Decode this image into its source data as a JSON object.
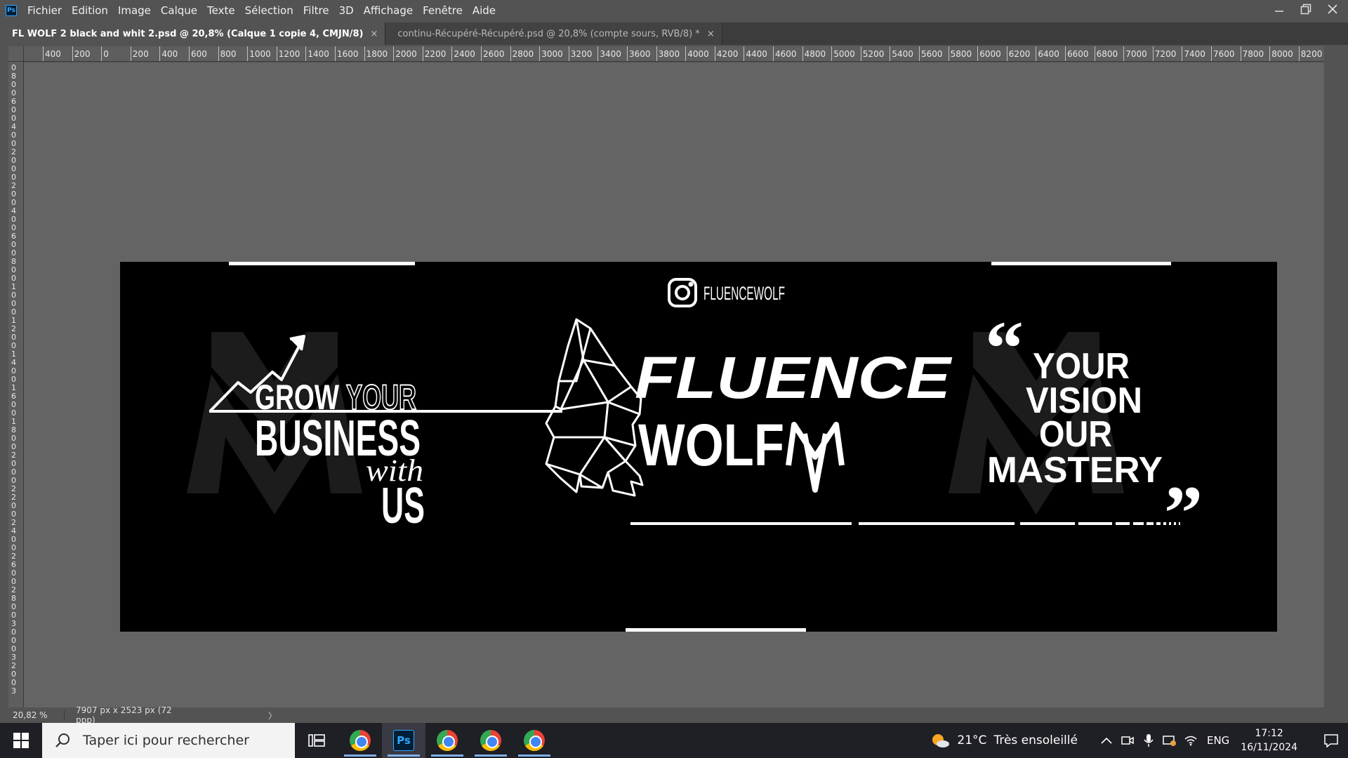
{
  "app": {
    "logo_text": "Ps",
    "menu": [
      "Fichier",
      "Edition",
      "Image",
      "Calque",
      "Texte",
      "Sélection",
      "Filtre",
      "3D",
      "Affichage",
      "Fenêtre",
      "Aide"
    ]
  },
  "tabs": [
    {
      "label": "FL WOLF 2 black and whit 2.psd @ 20,8% (Calque 1 copie 4, CMJN/8)",
      "close": "×",
      "active": true
    },
    {
      "label": "continu-Récupéré-Récupéré.psd @ 20,8% (compte sours, RVB/8) *",
      "close": "×",
      "active": false
    }
  ],
  "ruler": {
    "h_labels": [
      "400",
      "200",
      "0",
      "200",
      "400",
      "600",
      "800",
      "1000",
      "1200",
      "1400",
      "1600",
      "1800",
      "2000",
      "2200",
      "2400",
      "2600",
      "2800",
      "3000",
      "3200",
      "3400",
      "3600",
      "3800",
      "4000",
      "4200",
      "4400",
      "4600",
      "4800",
      "5000",
      "5200",
      "5400",
      "5600",
      "5800",
      "6000",
      "6200",
      "6400",
      "6600",
      "6800",
      "7000",
      "7200",
      "7400",
      "7600",
      "7800",
      "8000",
      "8200"
    ],
    "v_labels": [
      "0",
      "8",
      "0",
      "0",
      "6",
      "0",
      "0",
      "4",
      "0",
      "0",
      "2",
      "0",
      "0",
      "0",
      "2",
      "0",
      "0",
      "4",
      "0",
      "0",
      "6",
      "0",
      "0",
      "8",
      "0",
      "0",
      "1",
      "0",
      "0",
      "0",
      "1",
      "2",
      "0",
      "0",
      "1",
      "4",
      "0",
      "0",
      "1",
      "6",
      "0",
      "0",
      "1",
      "8",
      "0",
      "0",
      "2",
      "0",
      "0",
      "0",
      "2",
      "2",
      "0",
      "0",
      "2",
      "4",
      "0",
      "0",
      "2",
      "6",
      "0",
      "0",
      "2",
      "8",
      "0",
      "0",
      "3",
      "0",
      "0",
      "0",
      "3",
      "2",
      "0",
      "0",
      "3"
    ]
  },
  "artwork": {
    "instagram_handle": "FLUENCEWOLF",
    "left_line1a": "GROW",
    "left_line1b": "YOUR",
    "left_line2": "BUSINESS",
    "left_line3": "with",
    "left_line4": "US",
    "brand_line1": "FLUENCE",
    "brand_line2": "WOLF",
    "quote_open": "“",
    "quote_close": "”",
    "quote_line1": "YOUR",
    "quote_line2": "VISION",
    "quote_line3": "OUR",
    "quote_line4": "MASTERY"
  },
  "status": {
    "zoom": "20,82 %",
    "doc_size": "7907 px x 2523 px (72 ppp)",
    "arrow": "〉"
  },
  "taskbar": {
    "search_placeholder": "Taper ici pour rechercher",
    "weather_temp": "21°C",
    "weather_text": "Très ensoleillé",
    "lang": "ENG",
    "time": "17:12",
    "date": "16/11/2024"
  },
  "colors": {
    "ui_bg": "#535353",
    "workspace": "#646464",
    "canvas": "#000000",
    "ps_blue": "#31a8ff",
    "taskbar": "#1f1f26"
  }
}
